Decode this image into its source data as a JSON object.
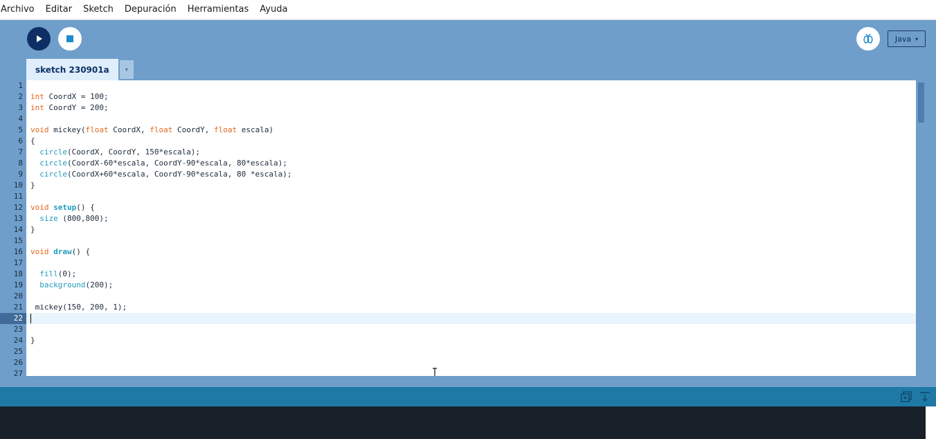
{
  "menu": [
    "Archivo",
    "Editar",
    "Sketch",
    "Depuración",
    "Herramientas",
    "Ayuda"
  ],
  "toolbar": {
    "run_icon": "play-icon",
    "stop_icon": "stop-icon",
    "debug_icon": "butterfly-debugger-icon",
    "mode_label": "Java",
    "mode_arrow": "▾"
  },
  "tabs": [
    {
      "label": "sketch 230901a"
    }
  ],
  "tab_menu_arrow": "▾",
  "editor": {
    "current_line": 22,
    "line_numbers": [
      "1",
      "2",
      "3",
      "4",
      "5",
      "6",
      "7",
      "8",
      "9",
      "10",
      "11",
      "12",
      "13",
      "14",
      "15",
      "16",
      "17",
      "18",
      "19",
      "20",
      "21",
      "22",
      "23",
      "24",
      "25",
      "26",
      "27"
    ]
  },
  "colors": {
    "accent": "#0e2f66",
    "background": "#6f9ecb",
    "keyword": "#e2661a",
    "function": "#1f9cbf",
    "status_bar": "#1f79a6",
    "console": "#18202a"
  },
  "status_icons": [
    "copy-icon",
    "scroll-to-bottom-icon"
  ]
}
